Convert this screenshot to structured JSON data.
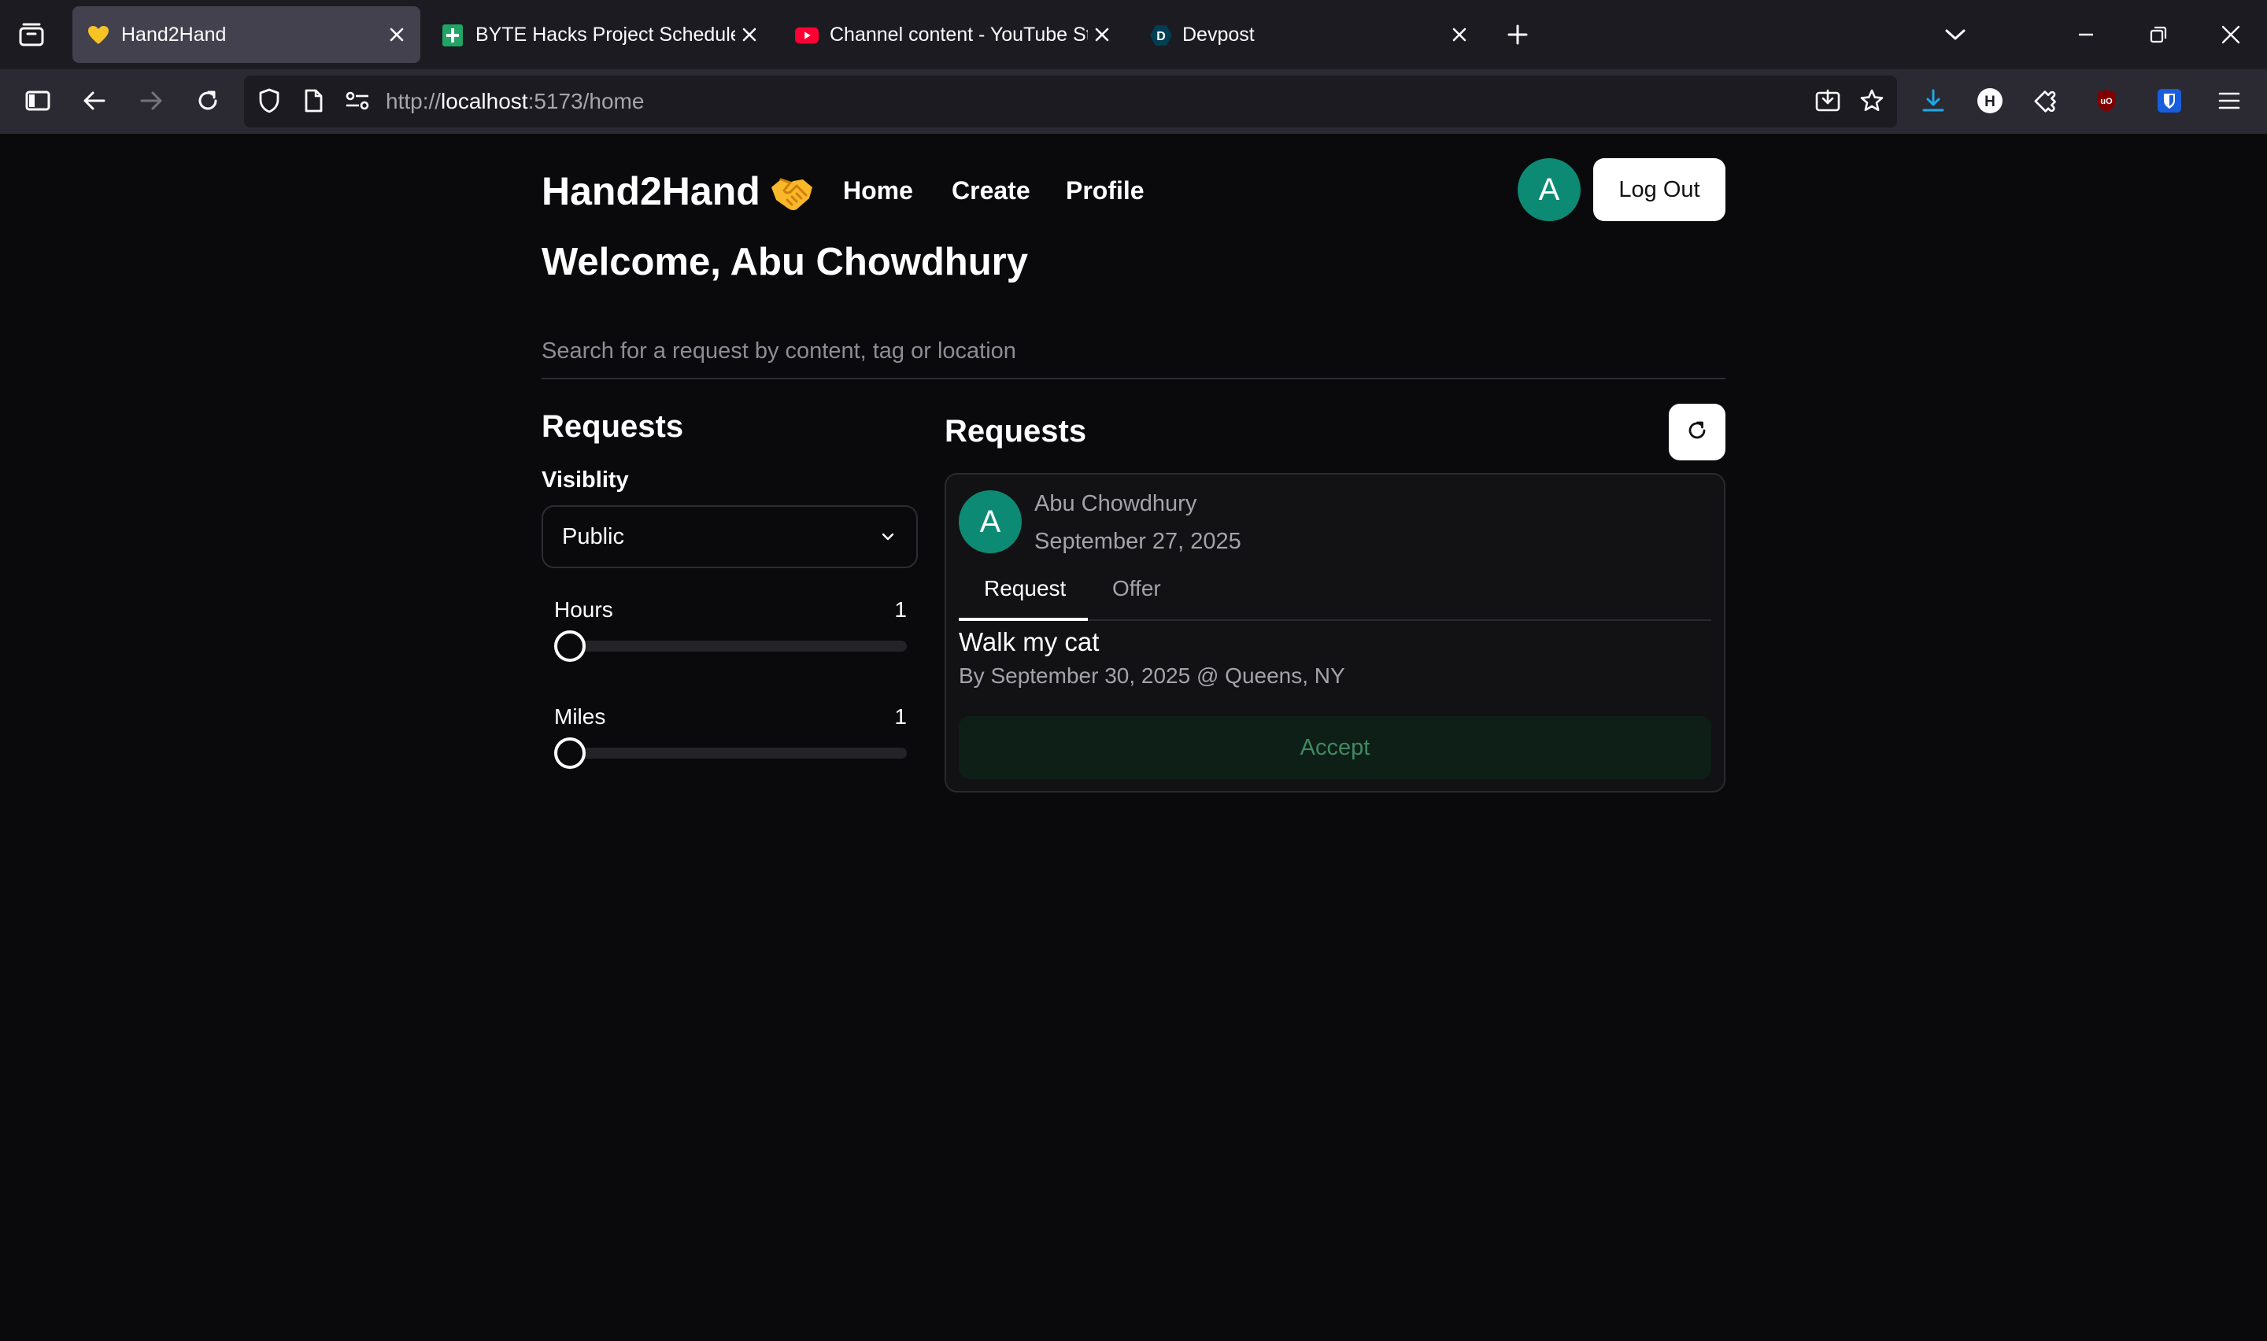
{
  "browser": {
    "tabs": [
      {
        "title": "Hand2Hand",
        "favicon": "heart-emoji-icon",
        "active": true
      },
      {
        "title": "BYTE Hacks Project Schedule - G",
        "favicon": "google-sheets-icon",
        "active": false
      },
      {
        "title": "Channel content - YouTube Stu",
        "favicon": "youtube-icon",
        "active": false
      },
      {
        "title": "Devpost",
        "favicon": "devpost-icon",
        "active": false
      }
    ],
    "url": {
      "scheme": "http://",
      "host": "localhost",
      "rest": ":5173/home"
    }
  },
  "app": {
    "brand": "Hand2Hand",
    "nav": {
      "home": "Home",
      "create": "Create",
      "profile": "Profile"
    },
    "avatar_initial": "A",
    "logout_label": "Log Out",
    "welcome": "Welcome, Abu Chowdhury",
    "search_placeholder": "Search for a request by content, tag or location"
  },
  "filters": {
    "title": "Requests",
    "visibility_label": "Visiblity",
    "visibility_value": "Public",
    "hours": {
      "label": "Hours",
      "value": "1"
    },
    "miles": {
      "label": "Miles",
      "value": "1"
    }
  },
  "feed": {
    "title": "Requests",
    "card": {
      "avatar_initial": "A",
      "author": "Abu Chowdhury",
      "date": "September 27, 2025",
      "tabs": {
        "request": "Request",
        "offer": "Offer"
      },
      "title": "Walk my cat",
      "details": "By September 30, 2025 @ Queens, NY",
      "accept_label": "Accept"
    }
  },
  "colors": {
    "accent": "#0d8a74",
    "accept_bg": "#0e1f17",
    "accept_text": "#3f8a61"
  }
}
